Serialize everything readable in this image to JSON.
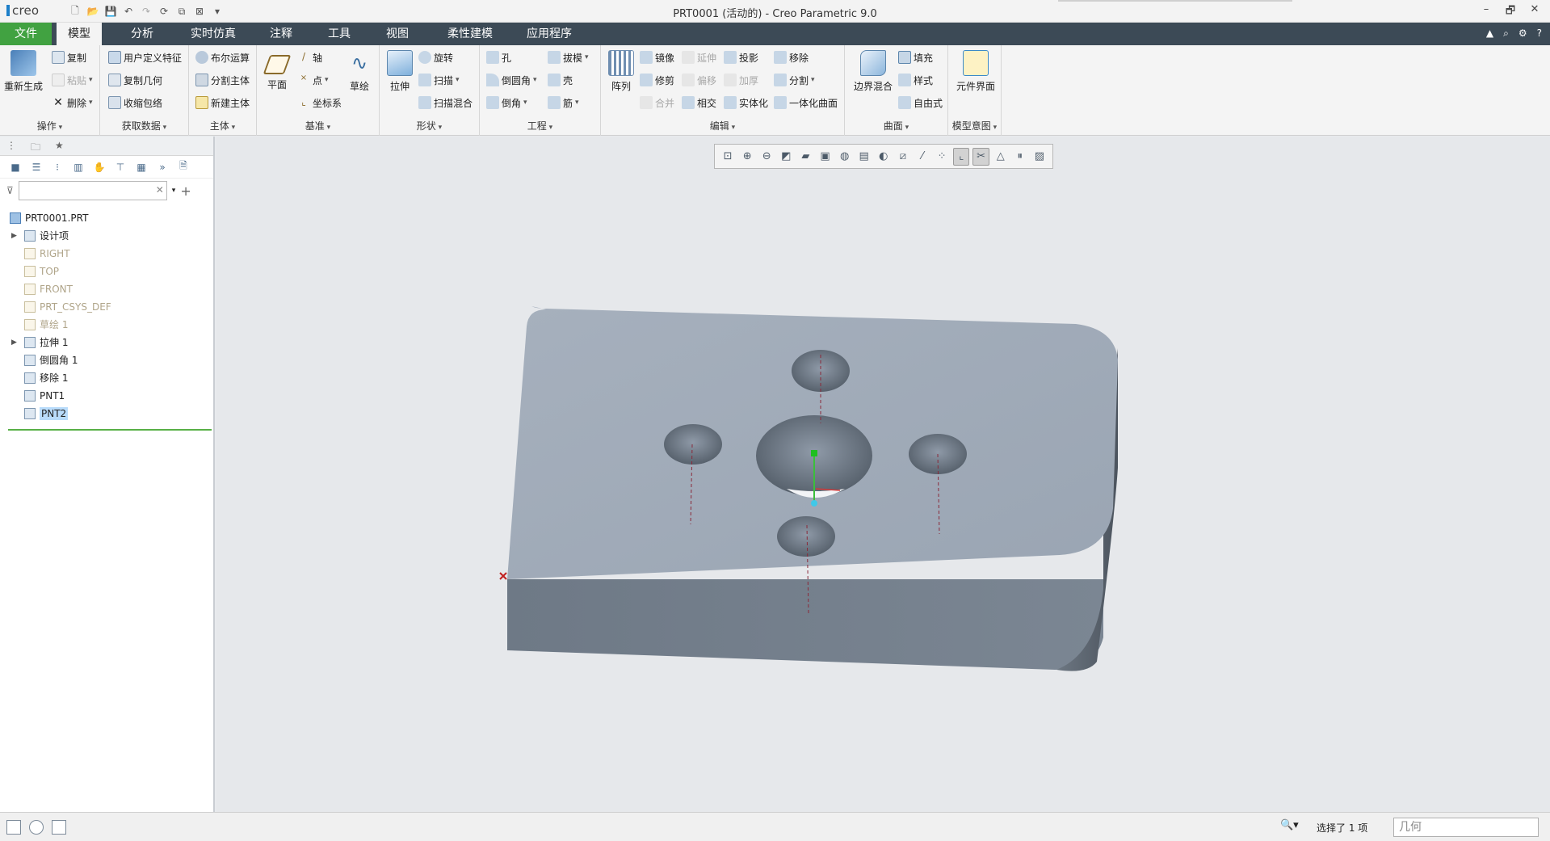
{
  "window": {
    "app_logo": "creo",
    "title": "PRT0001 (活动的) - Creo Parametric 9.0",
    "controls": [
      "–",
      "🗗",
      "✕"
    ]
  },
  "menu_tabs": [
    "文件",
    "模型",
    "分析",
    "实时仿真",
    "注释",
    "工具",
    "视图",
    "柔性建模",
    "应用程序"
  ],
  "ribbon": {
    "operations": {
      "label": "操作",
      "regenerate": "重新生成",
      "copy": "复制",
      "paste": "粘贴",
      "delete": "删除"
    },
    "get_data": {
      "label": "获取数据",
      "udf": "用户定义特征",
      "copy_geom": "复制几何",
      "shrinkwrap": "收缩包络"
    },
    "body": {
      "label": "主体",
      "boolean": "布尔运算",
      "split_body": "分割主体",
      "new_body": "新建主体"
    },
    "datum": {
      "label": "基准",
      "plane": "平面",
      "axis": "轴",
      "point": "点",
      "csys": "坐标系",
      "sketch": "草绘"
    },
    "shapes": {
      "label": "形状",
      "extrude": "拉伸",
      "revolve": "旋转",
      "sweep": "扫描",
      "swept_blend": "扫描混合"
    },
    "engineering": {
      "label": "工程",
      "hole": "孔",
      "round": "倒圆角",
      "chamfer": "倒角",
      "draft": "拔模",
      "shell": "壳",
      "rib": "筋"
    },
    "editing": {
      "label": "编辑",
      "pattern": "阵列",
      "mirror": "镜像",
      "trim": "修剪",
      "merge": "合并",
      "extend": "延伸",
      "offset": "偏移",
      "intersect": "相交",
      "project": "投影",
      "thicken": "加厚",
      "solidify": "实体化",
      "remove": "移除",
      "split": "分割",
      "unify": "一体化曲面"
    },
    "surfaces": {
      "label": "曲面",
      "boundary_blend": "边界混合",
      "fill": "填充",
      "style": "样式",
      "freestyle": "自由式"
    },
    "model_intent": {
      "label": "模型意图",
      "component_interface": "元件界面"
    }
  },
  "model_tree": {
    "root": "PRT0001.PRT",
    "items": [
      {
        "label": "设计项",
        "expandable": true,
        "state": "normal"
      },
      {
        "label": "RIGHT",
        "expandable": false,
        "state": "dim"
      },
      {
        "label": "TOP",
        "expandable": false,
        "state": "dim"
      },
      {
        "label": "FRONT",
        "expandable": false,
        "state": "dim"
      },
      {
        "label": "PRT_CSYS_DEF",
        "expandable": false,
        "state": "dim"
      },
      {
        "label": "草绘 1",
        "expandable": false,
        "state": "dim"
      },
      {
        "label": "拉伸 1",
        "expandable": true,
        "state": "normal"
      },
      {
        "label": "倒圆角 1",
        "expandable": false,
        "state": "normal"
      },
      {
        "label": "移除 1",
        "expandable": false,
        "state": "normal"
      },
      {
        "label": "PNT1",
        "expandable": false,
        "state": "normal"
      },
      {
        "label": "PNT2",
        "expandable": false,
        "state": "selected"
      }
    ]
  },
  "status": {
    "selection": "选择了 1 项",
    "filter_value": "几何"
  },
  "colors": {
    "accent_green": "#41a241",
    "tab_bar": "#3c4a56",
    "selection": "#b9dcfb",
    "part_top": "#a3adbb",
    "part_side": "#727d8a"
  }
}
